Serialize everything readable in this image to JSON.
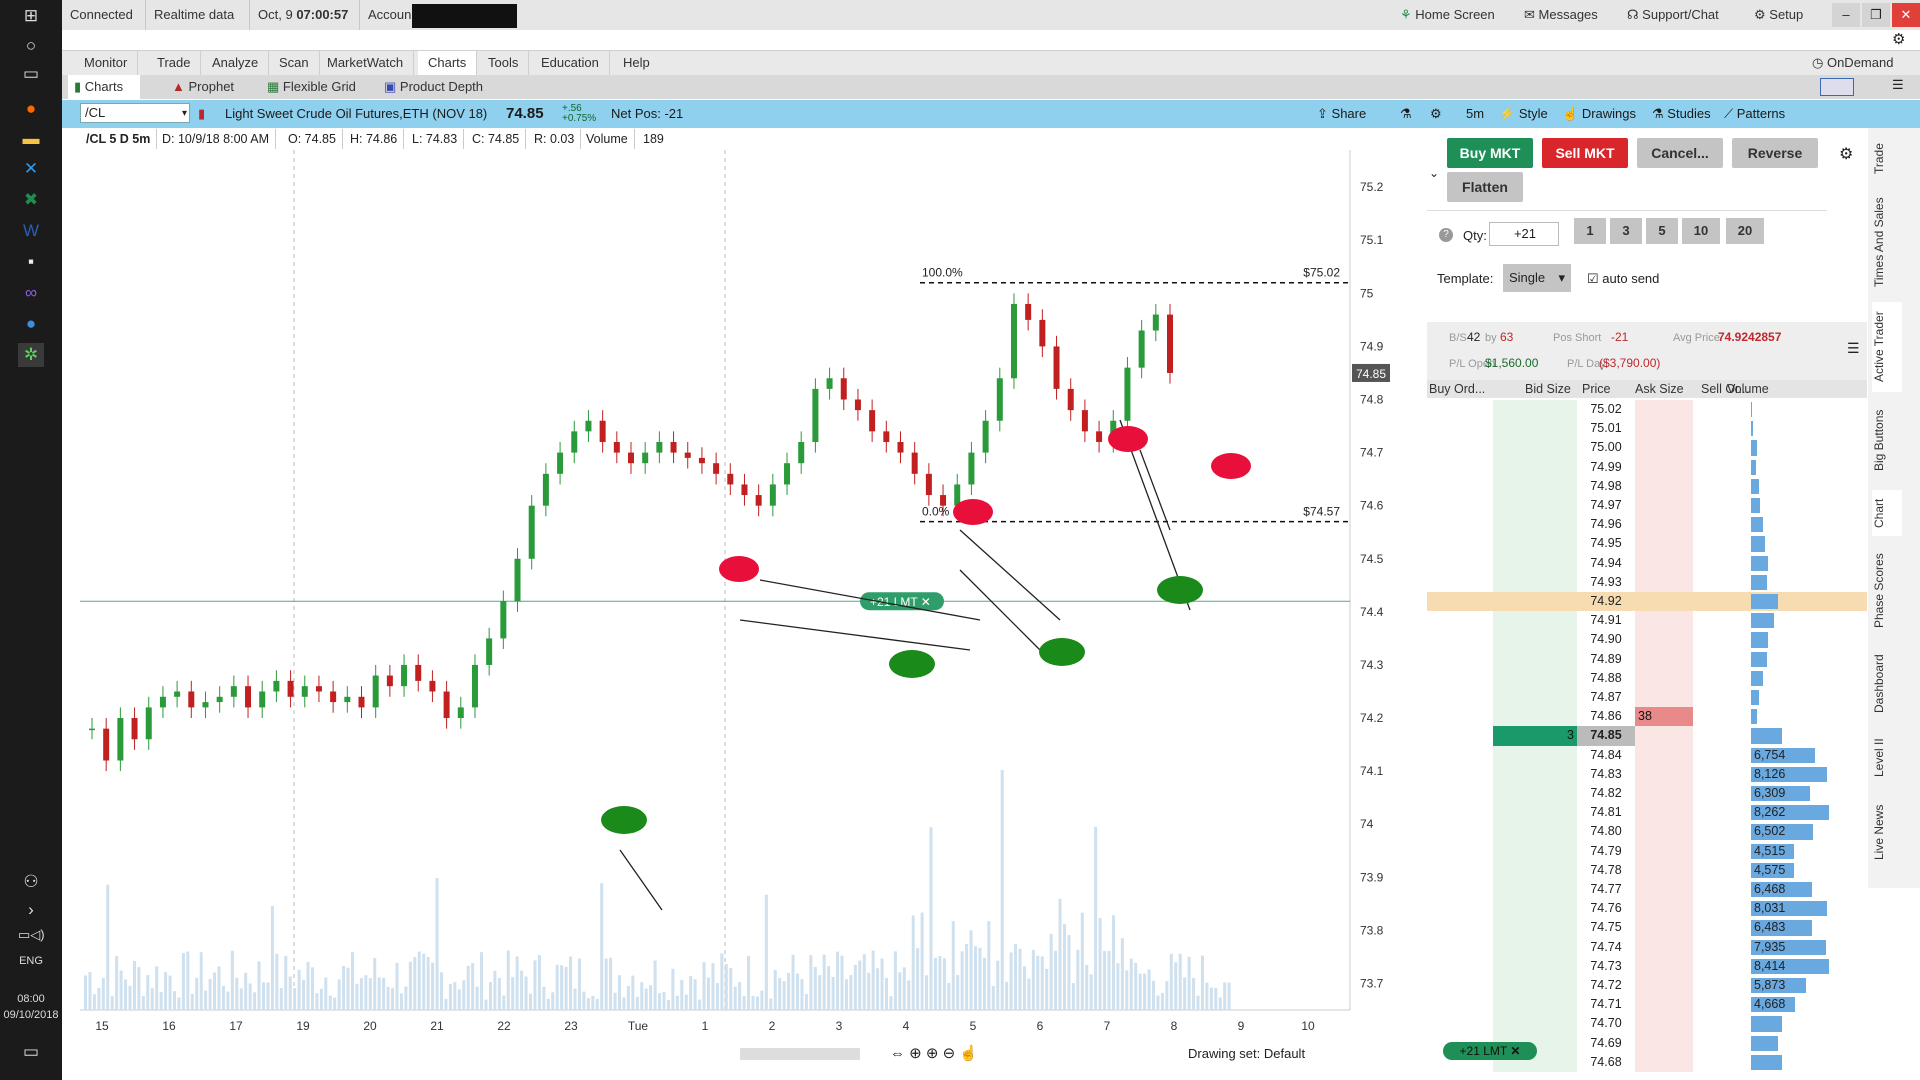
{
  "taskbar": {
    "icons": [
      "windows-start-icon",
      "cortana-icon",
      "task-view-icon",
      "firefox-icon",
      "file-explorer-icon",
      "vscode-icon",
      "excel-icon",
      "word-icon",
      "notes-icon",
      "visual-studio-icon",
      "app-icon",
      "thinkorswim-icon"
    ],
    "language": "ENG",
    "time": "08:00",
    "date": "09/10/2018"
  },
  "statusbar": {
    "connected": "Connected",
    "realtime": "Realtime data",
    "date": "Oct, 9",
    "time": "07:00:57",
    "account": "Accoun",
    "home_screen": "Home Screen",
    "messages": "Messages",
    "support": "Support/Chat",
    "setup": "Setup"
  },
  "nav": {
    "items": [
      "Monitor",
      "Trade",
      "Analyze",
      "Scan",
      "MarketWatch",
      "Charts",
      "Tools",
      "Education",
      "Help"
    ],
    "ondemand": "OnDemand"
  },
  "subnav": {
    "items": [
      "Charts",
      "Prophet",
      "Flexible Grid",
      "Product Depth"
    ]
  },
  "chartbar": {
    "symbol": "/CL",
    "description": "Light Sweet Crude Oil Futures,ETH (NOV 18)",
    "last": "74.85",
    "change_top": "+.56",
    "change_bottom": "+0.75%",
    "net_pos": "Net Pos: -21",
    "share": "Share",
    "timeframe": "5m",
    "style": "Style",
    "drawings": "Drawings",
    "studies": "Studies",
    "patterns": "Patterns"
  },
  "info": {
    "title": "/CL 5 D 5m",
    "date": "D: 10/9/18 8:00 AM",
    "open": "O: 74.85",
    "high": "H: 74.86",
    "low": "L: 74.83",
    "close": "C: 74.85",
    "range": "R: 0.03",
    "volume_label": "Volume",
    "volume": "189"
  },
  "chart_data": {
    "type": "candlestick",
    "title": "/CL 5 D 5m",
    "y_axis_ticks": [
      "75.2",
      "75.1",
      "75",
      "74.9",
      "74.8",
      "74.7",
      "74.6",
      "74.5",
      "74.4",
      "74.3",
      "74.2",
      "74.1",
      "74",
      "73.9",
      "73.8",
      "73.7"
    ],
    "x_axis_ticks": [
      "15",
      "16",
      "17",
      "19",
      "20",
      "21",
      "22",
      "23",
      "Tue",
      "1",
      "2",
      "3",
      "4",
      "5",
      "6",
      "7",
      "8",
      "9",
      "10"
    ],
    "ylim": [
      73.65,
      75.27
    ],
    "last_price": 74.85,
    "fib_levels": [
      {
        "label": "100.0%",
        "price": 75.02,
        "price_label": "$75.02"
      },
      {
        "label": "0.0%",
        "price": 74.57,
        "price_label": "$74.57"
      }
    ],
    "order_line": {
      "label": "+21 LMT",
      "price": 74.42
    },
    "series": [
      {
        "name": "Price",
        "values": [
          74.18,
          74.12,
          74.2,
          74.16,
          74.22,
          74.24,
          74.25,
          74.22,
          74.23,
          74.24,
          74.26,
          74.22,
          74.25,
          74.27,
          74.24,
          74.26,
          74.25,
          74.23,
          74.24,
          74.22,
          74.28,
          74.26,
          74.3,
          74.27,
          74.25,
          74.2,
          74.22,
          74.3,
          74.35,
          74.42,
          74.5,
          74.6,
          74.66,
          74.7,
          74.74,
          74.76,
          74.72,
          74.7,
          74.68,
          74.7,
          74.72,
          74.7,
          74.69,
          74.68,
          74.66,
          74.64,
          74.62,
          74.6,
          74.64,
          74.68,
          74.72,
          74.82,
          74.84,
          74.8,
          74.78,
          74.74,
          74.72,
          74.7,
          74.66,
          74.62,
          74.6,
          74.64,
          74.7,
          74.76,
          74.84,
          74.98,
          74.95,
          74.9,
          74.82,
          74.78,
          74.74,
          74.72,
          74.76,
          74.86,
          74.93,
          74.96,
          74.85
        ]
      }
    ]
  },
  "order_entry": {
    "buy_mkt": "Buy MKT",
    "sell_mkt": "Sell MKT",
    "cancel": "Cancel...",
    "reverse": "Reverse",
    "flatten": "Flatten",
    "qty_label": "Qty:",
    "qty_value": "+21",
    "qty_buttons": [
      "1",
      "3",
      "5",
      "10",
      "20"
    ],
    "template_label": "Template:",
    "template_value": "Single",
    "auto_send": "auto send"
  },
  "position": {
    "bs_label": "B/S",
    "bought": "42",
    "by": "by",
    "sold": "63",
    "pos_label": "Pos Short",
    "pos_value": "-21",
    "avg_label": "Avg Price",
    "avg_value": "74.9242857",
    "pl_open_label": "P/L Open",
    "pl_open": "$1,560.00",
    "pl_day_label": "P/L Day",
    "pl_day": "($3,790.00)"
  },
  "ladder": {
    "headers": [
      "Buy Ord...",
      "Bid Size",
      "Price",
      "Ask Size",
      "Sell Or...",
      "Volume"
    ],
    "rows": [
      {
        "price": "75.02",
        "vol": "",
        "bar": 0.01
      },
      {
        "price": "75.01",
        "vol": "",
        "bar": 0.03
      },
      {
        "price": "75.00",
        "vol": "",
        "bar": 0.08
      },
      {
        "price": "74.99",
        "vol": "",
        "bar": 0.06
      },
      {
        "price": "74.98",
        "vol": "",
        "bar": 0.1
      },
      {
        "price": "74.97",
        "vol": "",
        "bar": 0.12
      },
      {
        "price": "74.96",
        "vol": "",
        "bar": 0.15
      },
      {
        "price": "74.95",
        "vol": "",
        "bar": 0.18
      },
      {
        "price": "74.94",
        "vol": "",
        "bar": 0.22
      },
      {
        "price": "74.93",
        "vol": "",
        "bar": 0.2
      },
      {
        "price": "74.92",
        "vol": "",
        "bar": 0.35
      },
      {
        "price": "74.91",
        "vol": "",
        "bar": 0.3
      },
      {
        "price": "74.90",
        "vol": "",
        "bar": 0.22
      },
      {
        "price": "74.89",
        "vol": "",
        "bar": 0.2
      },
      {
        "price": "74.88",
        "vol": "",
        "bar": 0.16
      },
      {
        "price": "74.87",
        "vol": "",
        "bar": 0.1
      },
      {
        "price": "74.86",
        "vol": "",
        "bar": 0.08,
        "ask": "38"
      },
      {
        "price": "74.85",
        "vol": "",
        "bar": 0.4,
        "bid": "3"
      },
      {
        "price": "74.84",
        "vol": "6,754",
        "bar": 0.82
      },
      {
        "price": "74.83",
        "vol": "8,126",
        "bar": 0.98
      },
      {
        "price": "74.82",
        "vol": "6,309",
        "bar": 0.76
      },
      {
        "price": "74.81",
        "vol": "8,262",
        "bar": 1.0
      },
      {
        "price": "74.80",
        "vol": "6,502",
        "bar": 0.79
      },
      {
        "price": "74.79",
        "vol": "4,515",
        "bar": 0.55
      },
      {
        "price": "74.78",
        "vol": "4,575",
        "bar": 0.55
      },
      {
        "price": "74.77",
        "vol": "6,468",
        "bar": 0.78
      },
      {
        "price": "74.76",
        "vol": "8,031",
        "bar": 0.97
      },
      {
        "price": "74.75",
        "vol": "6,483",
        "bar": 0.78
      },
      {
        "price": "74.74",
        "vol": "7,935",
        "bar": 0.96
      },
      {
        "price": "74.73",
        "vol": "8,414",
        "bar": 1.0
      },
      {
        "price": "74.72",
        "vol": "5,873",
        "bar": 0.71
      },
      {
        "price": "74.71",
        "vol": "4,668",
        "bar": 0.56
      },
      {
        "price": "74.70",
        "vol": "",
        "bar": 0.4
      },
      {
        "price": "74.69",
        "vol": "",
        "bar": 0.35
      },
      {
        "price": "74.68",
        "vol": "",
        "bar": 0.4
      }
    ],
    "working_order": "+21 LMT"
  },
  "side_tabs": [
    "Trade",
    "Times And Sales",
    "Active Trader",
    "Big Buttons",
    "Chart",
    "Phase Scores",
    "Dashboard",
    "Level II",
    "Live News"
  ],
  "footer": {
    "drawing_set": "Drawing set: Default"
  }
}
